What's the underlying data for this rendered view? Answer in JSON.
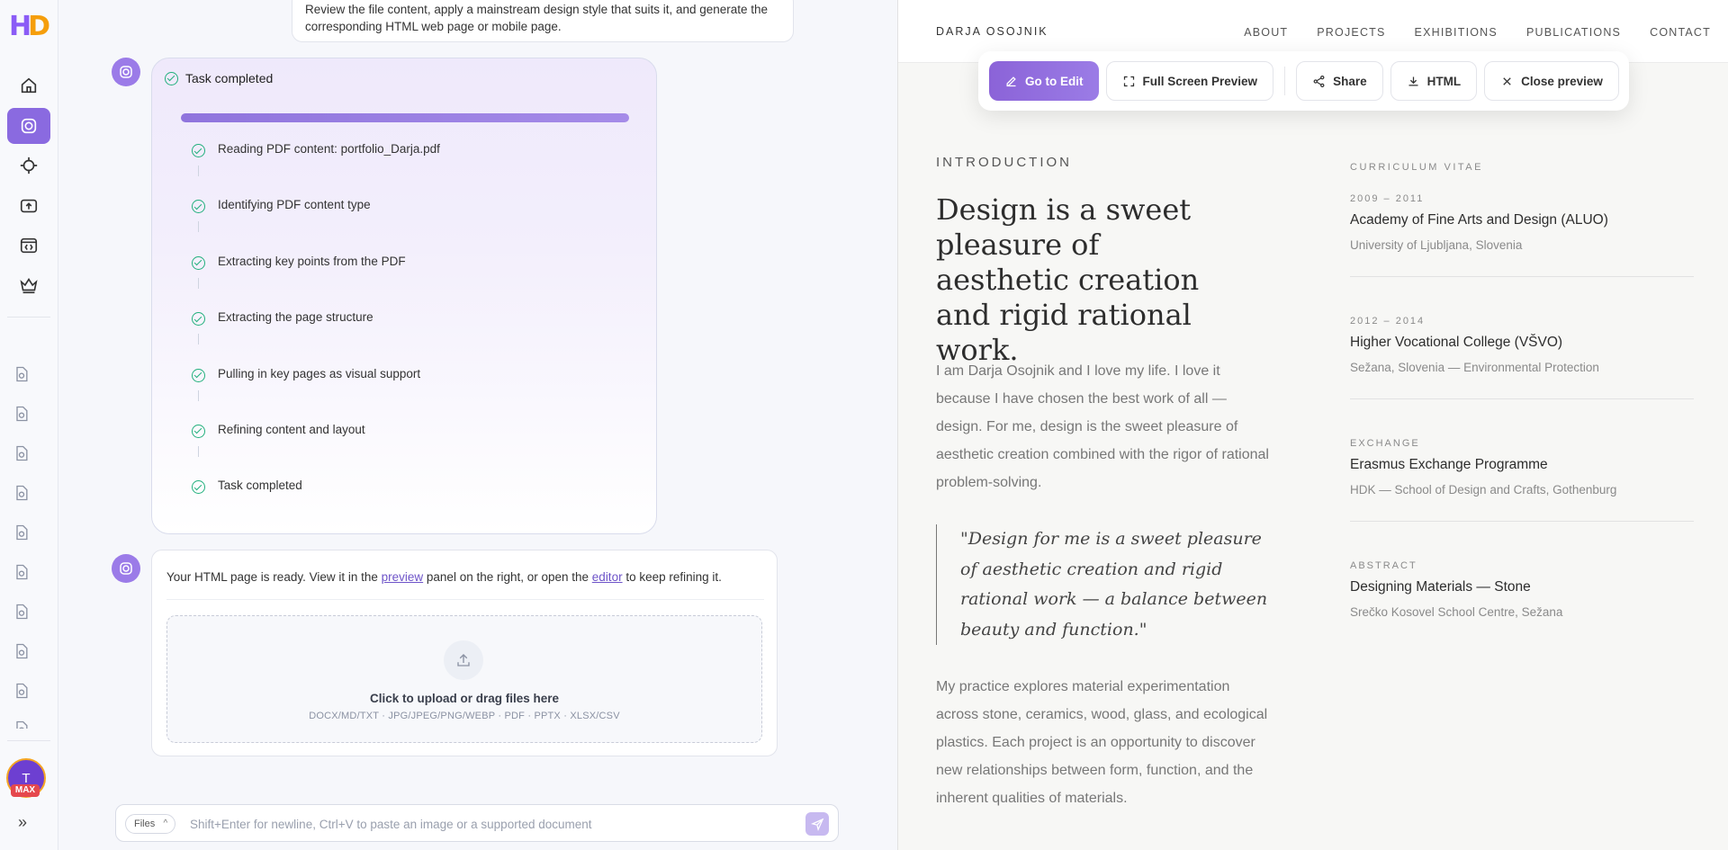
{
  "rail": {
    "logo_a": "H",
    "logo_b": "D",
    "avatar_initial": "T",
    "max_badge": "MAX",
    "expand": "»"
  },
  "chat": {
    "user_message": "Review the file content, apply a mainstream design style that suits it, and generate the corresponding HTML web page or mobile page.",
    "task_card": {
      "title": "Task completed",
      "progress_percent": 100,
      "steps": [
        "Reading PDF content: portfolio_Darja.pdf",
        "Identifying PDF content type",
        "Extracting key points from the PDF",
        "Extracting the page structure",
        "Pulling in key pages as visual support",
        "Refining content and layout",
        "Task completed"
      ]
    },
    "reply": {
      "text_before": "Your HTML page is ready. View it in the ",
      "preview_link": "preview",
      "text_middle": " panel on the right, or open the ",
      "editor_link": "editor",
      "text_after": " to keep refining it."
    },
    "upload": {
      "title": "Click to upload or drag files here",
      "formats": "DOCX/MD/TXT · JPG/JPEG/PNG/WEBP · PDF · PPTX · XLSX/CSV"
    },
    "composer": {
      "files_label": "Files",
      "placeholder": "Shift+Enter for newline, Ctrl+V to paste an image or a supported document"
    }
  },
  "preview": {
    "brand": "DARJA OSOJNIK",
    "nav": [
      "ABOUT",
      "PROJECTS",
      "EXHIBITIONS",
      "PUBLICATIONS",
      "CONTACT"
    ],
    "toolbar": {
      "edit": "Go to Edit",
      "fullscreen": "Full Screen Preview",
      "share": "Share",
      "html": "HTML",
      "close": "Close preview"
    },
    "intro_label": "INTRODUCTION",
    "headline": "Design is a sweet pleasure of aesthetic creation and rigid rational work.",
    "paragraph1": "I am Darja Osojnik and I love my life. I love it because I have chosen the best work of all — design. For me, design is the sweet pleasure of aesthetic creation combined with the rigor of rational problem-solving.",
    "quote": "\"Design for me is a sweet pleasure of aesthetic creation and rigid rational work — a balance between beauty and function.\"",
    "paragraph2": "My practice explores material experimentation across stone, ceramics, wood, glass, and ecological plastics. Each project is an opportunity to discover new relationships between form, function, and the inherent qualities of materials.",
    "cv_label": "CURRICULUM VITAE",
    "cv": [
      {
        "date": "2009 – 2011",
        "title": "Academy of Fine Arts and Design (ALUO)",
        "sub": "University of Ljubljana, Slovenia"
      },
      {
        "date": "2012 – 2014",
        "title": "Higher Vocational College (VŠVO)",
        "sub": "Sežana, Slovenia — Environmental Protection"
      },
      {
        "date": "EXCHANGE",
        "title": "Erasmus Exchange Programme",
        "sub": "HDK — School of Design and Crafts, Gothenburg"
      },
      {
        "date": "ABSTRACT",
        "title": "Designing Materials — Stone",
        "sub": "Srečko Kosovel School Centre, Sežana"
      }
    ]
  }
}
